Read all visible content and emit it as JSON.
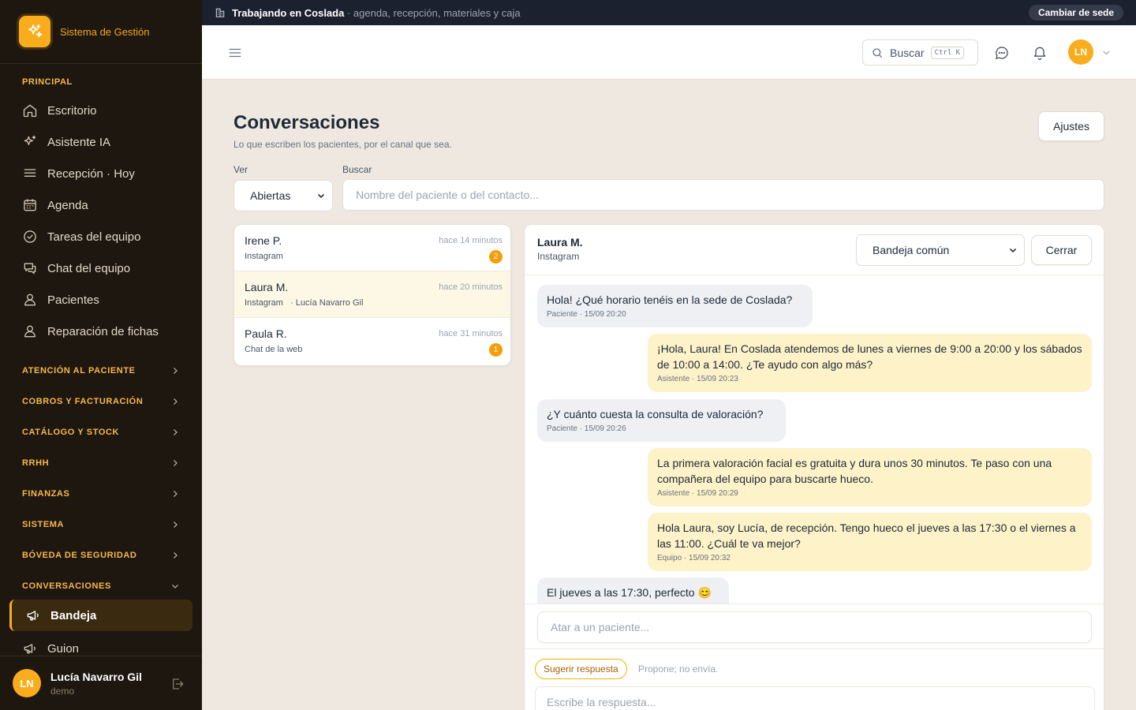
{
  "brand": {
    "name": "Sistema de Gestión"
  },
  "sidebar": {
    "section_principal": "PRINCIPAL",
    "items": [
      {
        "label": "Escritorio",
        "icon": "home-icon"
      },
      {
        "label": "Asistente IA",
        "icon": "sparkles-icon"
      },
      {
        "label": "Recepción · Hoy",
        "icon": "list-icon"
      },
      {
        "label": "Agenda",
        "icon": "calendar-icon"
      },
      {
        "label": "Tareas del equipo",
        "icon": "check-circle-icon"
      },
      {
        "label": "Chat del equipo",
        "icon": "chat-icon"
      },
      {
        "label": "Pacientes",
        "icon": "user-icon"
      },
      {
        "label": "Reparación de fichas",
        "icon": "user-icon"
      }
    ],
    "groups": [
      {
        "label": "ATENCIÓN AL PACIENTE"
      },
      {
        "label": "COBROS Y FACTURACIÓN"
      },
      {
        "label": "CATÁLOGO Y STOCK"
      },
      {
        "label": "RRHH"
      },
      {
        "label": "FINANZAS"
      },
      {
        "label": "SISTEMA"
      },
      {
        "label": "BÓVEDA DE SEGURIDAD"
      },
      {
        "label": "CONVERSACIONES"
      }
    ],
    "conv_items": [
      {
        "label": "Bandeja",
        "icon": "megaphone-icon",
        "active": true
      },
      {
        "label": "Guion",
        "icon": "megaphone-icon"
      }
    ],
    "user": {
      "initials": "LN",
      "name": "Lucía Navarro Gil",
      "role": "demo"
    }
  },
  "topbar": {
    "working_prefix": "Trabajando en",
    "location": "Coslada",
    "description": "· agenda, recepción, materiales y caja",
    "change_site": "Cambiar de sede"
  },
  "header": {
    "search_label": "Buscar",
    "shortcut": "Ctrl K",
    "avatar_initials": "LN"
  },
  "page": {
    "title": "Conversaciones",
    "subtitle": "Lo que escriben los pacientes, por el canal que sea.",
    "settings_button": "Ajustes",
    "filter_label": "Ver",
    "filter_value": "Abiertas",
    "search_label": "Buscar",
    "search_placeholder": "Nombre del paciente o del contacto..."
  },
  "conversations": [
    {
      "name": "Irene P.",
      "channel": "Instagram",
      "time": "hace 14 minutos",
      "badge": "2"
    },
    {
      "name": "Laura M.",
      "channel": "Instagram",
      "assignee": "· Lucía Navarro Gil",
      "time": "hace 20 minutos"
    },
    {
      "name": "Paula R.",
      "channel": "Chat de la web",
      "time": "hace 31 minutos",
      "badge": "1"
    }
  ],
  "chat": {
    "name": "Laura M.",
    "channel": "Instagram",
    "inbox": "Bandeja común",
    "close_button": "Cerrar",
    "messages": [
      {
        "text": "Hola! ¿Qué horario tenéis en la sede de Coslada?",
        "meta": "Paciente · 15/09 20:20"
      },
      {
        "text": "¡Hola, Laura! En Coslada atendemos de lunes a viernes de 9:00 a 20:00 y los sábados de 10:00 a 14:00. ¿Te ayudo con algo más?",
        "meta": "Asistente · 15/09 20:23"
      },
      {
        "text": "¿Y cuánto cuesta la consulta de valoración?",
        "meta": "Paciente · 15/09 20:26"
      },
      {
        "text": "La primera valoración facial es gratuita y dura unos 30 minutos. Te paso con una compañera del equipo para buscarte hueco.",
        "meta": "Asistente · 15/09 20:29"
      },
      {
        "text": "Hola Laura, soy Lucía, de recepción. Tengo hueco el jueves a las 17:30 o el viernes a las 11:00. ¿Cuál te va mejor?",
        "meta": "Equipo · 15/09 20:32"
      },
      {
        "text": "El jueves a las 17:30, perfecto 😊"
      }
    ],
    "link_placeholder": "Atar a un paciente...",
    "suggest_button": "Sugerir respuesta",
    "suggest_note": "Propone; no envía.",
    "reply_placeholder": "Escribe la respuesta..."
  },
  "colors": {
    "accent": "#f9ad1d",
    "sidebar": "#1e1710",
    "topbar": "#1c2130",
    "background": "#eee8e0"
  }
}
